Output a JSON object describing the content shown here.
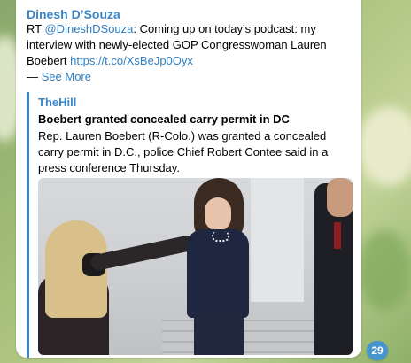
{
  "message": {
    "sender": "Dinesh D’Souza",
    "text_prefix": "RT ",
    "mention": "@DineshDSouza",
    "text_after_mention": ": Coming up on today’s podcast: my interview with newly-elected GOP Congresswoman Lauren Boebert ",
    "link": "https://t.co/XsBeJp0Oyx",
    "see_more_prefix": "— ",
    "see_more_label": "See More"
  },
  "preview": {
    "site_name": "TheHill",
    "title": "Boebert granted concealed carry permit in DC",
    "description": "Rep. Lauren Boebert (R-Colo.) was granted a concealed carry permit in D.C., police Chief Robert Contee said in a press conference Thursday."
  },
  "unread_badge": "29",
  "colors": {
    "accent": "#3a86c8",
    "link": "#2f7fc1",
    "badge": "#4596cf"
  }
}
